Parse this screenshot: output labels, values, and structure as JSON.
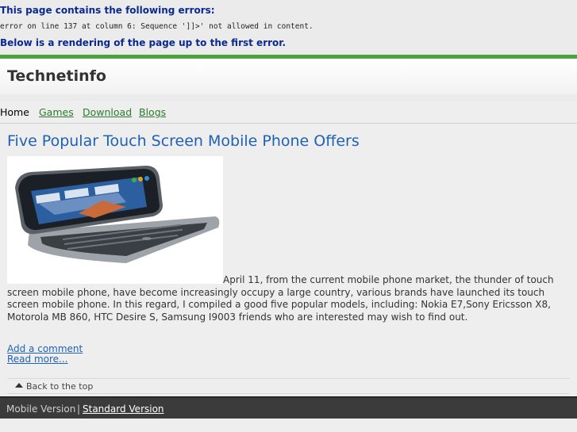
{
  "error": {
    "title": "This page contains the following errors:",
    "detail": "error on line 137 at column 6: Sequence ']]>' not allowed in content.",
    "note": "Below is a rendering of the page up to the first error."
  },
  "site": {
    "title": "Technetinfo"
  },
  "nav": {
    "items": [
      {
        "label": "Home"
      },
      {
        "label": "Games"
      },
      {
        "label": "Download"
      },
      {
        "label": "Blogs"
      }
    ]
  },
  "post": {
    "title": "Five Popular Touch Screen Mobile Phone Offers",
    "image_icon": "smartphone-icon",
    "body": "April 11, from the current mobile phone market, the thunder of touch screen mobile phone, have become increasingly occupy a large country, various brands have launched its touch screen mobile phone. In this regard, I compiled a good five popular models, including: Nokia E7,Sony Ericsson X8, Motorola MB 860, HTC Desire S, Samsung I9003 friends who are interested may wish to find out.",
    "comment_link": "Add a comment",
    "more_link": "Read more..."
  },
  "back_to_top": {
    "label": "Back to the top",
    "icon": "up-arrow-icon"
  },
  "footer": {
    "mobile": "Mobile Version",
    "separator": "|",
    "standard": "Standard Version"
  },
  "colors": {
    "accent_green": "#4aa33c",
    "link_blue": "#1f62b4",
    "nav_green": "#2c7a2c",
    "error_blue": "#0b2a8f",
    "footer_bg": "#3b3b3b"
  }
}
